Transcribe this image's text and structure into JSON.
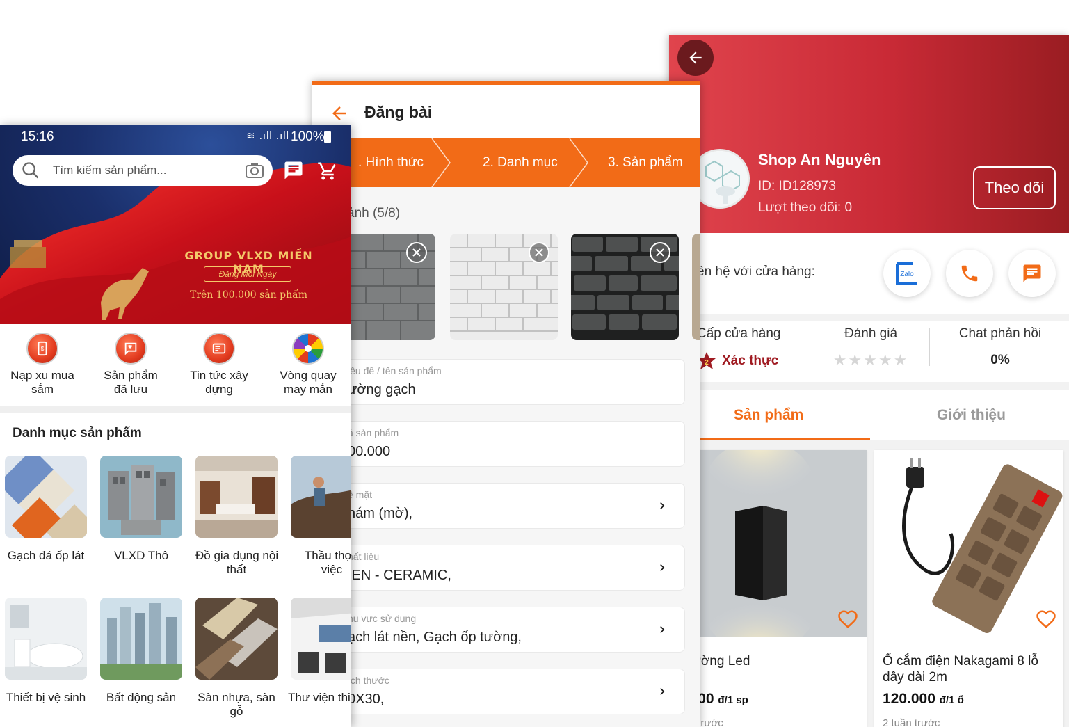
{
  "shop_screen": {
    "back_icon": "arrow-left-icon",
    "shop_name": "Shop An Nguyên",
    "shop_id": "ID: ID128973",
    "followers": "Lượt theo dõi: 0",
    "follow_button": "Theo dõi",
    "contact_label": "ên hệ với cửa hàng:",
    "contact_buttons": [
      {
        "icon": "zalo-icon",
        "label": "Zalo"
      },
      {
        "icon": "phone-icon"
      },
      {
        "icon": "chat-icon"
      }
    ],
    "stats": {
      "level_label": "Cấp cửa hàng",
      "level_badge": "2",
      "level_value": "Xác thực",
      "rating_label": "Đánh giá",
      "rating_stars": 0,
      "response_label": "Chat phản hồi",
      "response_value": "0%"
    },
    "tabs": [
      "Sản phẩm",
      "Giới thiệu"
    ],
    "active_tab": 0,
    "products": [
      {
        "name": "n tường Led",
        "price": "5.000",
        "unit": "đ/1 sp",
        "time": "uần trước"
      },
      {
        "name_line1": "Ổ cắm điện Nakagami 8 lỗ",
        "name_line2": "dây dài 2m",
        "price": "120.000",
        "unit": "đ/1 ổ",
        "time": "2 tuần trước"
      }
    ],
    "colors": {
      "header_start": "#e0444d",
      "header_end": "#9a1d22",
      "accent": "#f26b17"
    }
  },
  "post_screen": {
    "title": "Đăng bài",
    "back_icon": "arrow-left-icon",
    "steps": [
      ". Hình thức",
      "2. Danh mục",
      "3. Sản phẩm"
    ],
    "photos_label": "ảnh (5/8)",
    "fields": [
      {
        "label": "iêu đề / tên sản phẩm",
        "value": "ường gạch",
        "chevron": false
      },
      {
        "label": "á sản phẩm",
        "value": "00.000",
        "chevron": false
      },
      {
        "label": "ề mặt",
        "value": "hám (mờ),",
        "chevron": true
      },
      {
        "label": "hất liệu",
        "value": "IEN - CERAMIC,",
        "chevron": true
      },
      {
        "label": "hu vực sử dụng",
        "value": "ạch lát nền, Gạch ốp tường,",
        "chevron": true
      },
      {
        "label": "ích thước",
        "value": "0X30,",
        "chevron": true
      }
    ]
  },
  "home_screen": {
    "status_time": "15:16",
    "status_battery": "100%",
    "search_placeholder": "Tìm kiếm sản phẩm...",
    "banner": {
      "title": "GROUP VLXD MIỀN NAM",
      "subtitle": "Đăng Mỗi Ngày",
      "tagline": "Trên 100.000 sản phẩm"
    },
    "quick_actions": [
      {
        "line1": "Nạp xu mua",
        "line2": "sắm",
        "icon": "wallet-phone-icon"
      },
      {
        "line1": "Sản phẩm",
        "line2": "đã lưu",
        "icon": "saved-heart-icon"
      },
      {
        "line1": "Tin tức xây",
        "line2": "dựng",
        "icon": "news-icon"
      },
      {
        "line1": "Vòng quay",
        "line2": "may mắn",
        "icon": "lucky-wheel-icon"
      }
    ],
    "category_title": "Danh mục sản phẩm",
    "categories": [
      {
        "line1": "Gạch đá ốp lát",
        "line2": ""
      },
      {
        "line1": "VLXD Thô",
        "line2": ""
      },
      {
        "line1": "Đồ gia dụng nội",
        "line2": "thất"
      },
      {
        "line1": "Thầu thợ t",
        "line2": "việc"
      },
      {
        "line1": "Thiết bị vệ sinh",
        "line2": ""
      },
      {
        "line1": "Bất động sản",
        "line2": ""
      },
      {
        "line1": "Sàn nhựa, sàn",
        "line2": "gỗ"
      },
      {
        "line1": "Thư viện thi",
        "line2": ""
      }
    ]
  }
}
